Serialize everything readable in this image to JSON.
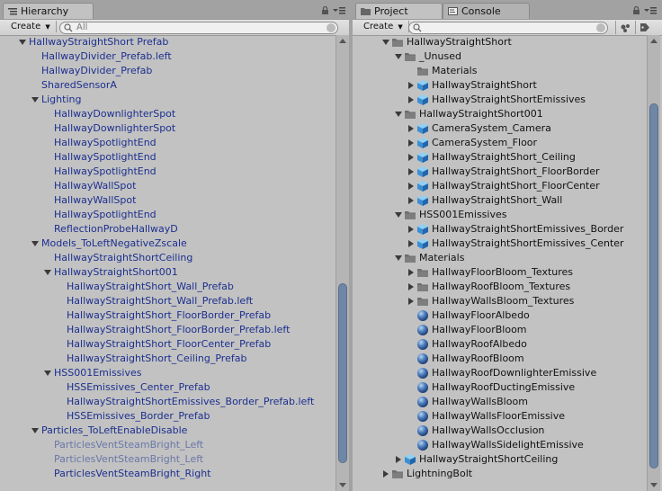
{
  "hierarchy": {
    "tab_label": "Hierarchy",
    "create_label": "Create",
    "search_placeholder": "All",
    "rows": [
      {
        "text": "HallwayStraightShort Prefab",
        "indent": 0,
        "arrow": "down",
        "color": "#1c2f8f"
      },
      {
        "text": "HallwayDivider_Prefab.left",
        "indent": 1,
        "arrow": "",
        "color": "#1c2f8f"
      },
      {
        "text": "HallwayDivider_Prefab",
        "indent": 1,
        "arrow": "",
        "color": "#1c2f8f"
      },
      {
        "text": "SharedSensorA",
        "indent": 1,
        "arrow": "",
        "color": "#1c2f8f"
      },
      {
        "text": "Lighting",
        "indent": 1,
        "arrow": "down",
        "color": "#1c2f8f"
      },
      {
        "text": "HallwayDownlighterSpot",
        "indent": 2,
        "arrow": "",
        "color": "#1c2f8f"
      },
      {
        "text": "HallwayDownlighterSpot",
        "indent": 2,
        "arrow": "",
        "color": "#1c2f8f"
      },
      {
        "text": "HallwaySpotlightEnd",
        "indent": 2,
        "arrow": "",
        "color": "#1c2f8f"
      },
      {
        "text": "HallwaySpotlightEnd",
        "indent": 2,
        "arrow": "",
        "color": "#1c2f8f"
      },
      {
        "text": "HallwaySpotlightEnd",
        "indent": 2,
        "arrow": "",
        "color": "#1c2f8f"
      },
      {
        "text": "HallwayWallSpot",
        "indent": 2,
        "arrow": "",
        "color": "#1c2f8f"
      },
      {
        "text": "HallwayWallSpot",
        "indent": 2,
        "arrow": "",
        "color": "#1c2f8f"
      },
      {
        "text": "HallwaySpotlightEnd",
        "indent": 2,
        "arrow": "",
        "color": "#1c2f8f"
      },
      {
        "text": "ReflectionProbeHallwayD",
        "indent": 2,
        "arrow": "",
        "color": "#1c2f8f"
      },
      {
        "text": "Models_ToLeftNegativeZscale",
        "indent": 1,
        "arrow": "down",
        "color": "#1c2f8f"
      },
      {
        "text": "HallwayStraightShortCeiling",
        "indent": 2,
        "arrow": "",
        "color": "#1c2f8f"
      },
      {
        "text": "HallwayStraightShort001",
        "indent": 2,
        "arrow": "down",
        "color": "#1c2f8f"
      },
      {
        "text": "HallwayStraightShort_Wall_Prefab",
        "indent": 3,
        "arrow": "",
        "color": "#1c2f8f"
      },
      {
        "text": "HallwayStraightShort_Wall_Prefab.left",
        "indent": 3,
        "arrow": "",
        "color": "#1c2f8f"
      },
      {
        "text": "HallwayStraightShort_FloorBorder_Prefab",
        "indent": 3,
        "arrow": "",
        "color": "#1c2f8f"
      },
      {
        "text": "HallwayStraightShort_FloorBorder_Prefab.left",
        "indent": 3,
        "arrow": "",
        "color": "#1c2f8f"
      },
      {
        "text": "HallwayStraightShort_FloorCenter_Prefab",
        "indent": 3,
        "arrow": "",
        "color": "#1c2f8f"
      },
      {
        "text": "HallwayStraightShort_Ceiling_Prefab",
        "indent": 3,
        "arrow": "",
        "color": "#1c2f8f"
      },
      {
        "text": "HSS001Emissives",
        "indent": 2,
        "arrow": "down",
        "color": "#1c2f8f"
      },
      {
        "text": "HSSEmissives_Center_Prefab",
        "indent": 3,
        "arrow": "",
        "color": "#1c2f8f"
      },
      {
        "text": "HallwayStraightShortEmissives_Border_Prefab.left",
        "indent": 3,
        "arrow": "",
        "color": "#1c2f8f"
      },
      {
        "text": "HSSEmissives_Border_Prefab",
        "indent": 3,
        "arrow": "",
        "color": "#1c2f8f"
      },
      {
        "text": "Particles_ToLeftEnableDisable",
        "indent": 1,
        "arrow": "down",
        "color": "#1c2f8f"
      },
      {
        "text": "ParticlesVentSteamBright_Left",
        "indent": 2,
        "arrow": "",
        "color": "#6a78a8"
      },
      {
        "text": "ParticlesVentSteamBright_Left",
        "indent": 2,
        "arrow": "",
        "color": "#6a78a8"
      },
      {
        "text": "ParticlesVentSteamBright_Right",
        "indent": 2,
        "arrow": "",
        "color": "#1c2f8f"
      }
    ]
  },
  "project": {
    "tab_label": "Project",
    "console_tab_label": "Console",
    "create_label": "Create",
    "search_placeholder": "",
    "rows": [
      {
        "text": "HallwayStraightShort",
        "indent": 0,
        "arrow": "down",
        "icon": "folder"
      },
      {
        "text": "_Unused",
        "indent": 1,
        "arrow": "down",
        "icon": "folder"
      },
      {
        "text": "Materials",
        "indent": 2,
        "arrow": "",
        "icon": "folder"
      },
      {
        "text": "HallwayStraightShort",
        "indent": 2,
        "arrow": "right",
        "icon": "prefab"
      },
      {
        "text": "HallwayStraightShortEmissives",
        "indent": 2,
        "arrow": "right",
        "icon": "prefab"
      },
      {
        "text": "HallwayStraightShort001",
        "indent": 1,
        "arrow": "down",
        "icon": "folder"
      },
      {
        "text": "CameraSystem_Camera",
        "indent": 2,
        "arrow": "right",
        "icon": "prefab"
      },
      {
        "text": "CameraSystem_Floor",
        "indent": 2,
        "arrow": "right",
        "icon": "prefab"
      },
      {
        "text": "HallwayStraightShort_Ceiling",
        "indent": 2,
        "arrow": "right",
        "icon": "prefab"
      },
      {
        "text": "HallwayStraightShort_FloorBorder",
        "indent": 2,
        "arrow": "right",
        "icon": "prefab"
      },
      {
        "text": "HallwayStraightShort_FloorCenter",
        "indent": 2,
        "arrow": "right",
        "icon": "prefab"
      },
      {
        "text": "HallwayStraightShort_Wall",
        "indent": 2,
        "arrow": "right",
        "icon": "prefab"
      },
      {
        "text": "HSS001Emissives",
        "indent": 1,
        "arrow": "down",
        "icon": "folder"
      },
      {
        "text": "HallwayStraightShortEmissives_Border",
        "indent": 2,
        "arrow": "right",
        "icon": "prefab"
      },
      {
        "text": "HallwayStraightShortEmissives_Center",
        "indent": 2,
        "arrow": "right",
        "icon": "prefab"
      },
      {
        "text": "Materials",
        "indent": 1,
        "arrow": "down",
        "icon": "folder"
      },
      {
        "text": "HallwayFloorBloom_Textures",
        "indent": 2,
        "arrow": "right",
        "icon": "folder"
      },
      {
        "text": "HallwayRoofBloom_Textures",
        "indent": 2,
        "arrow": "right",
        "icon": "folder"
      },
      {
        "text": "HallwayWallsBloom_Textures",
        "indent": 2,
        "arrow": "right",
        "icon": "folder"
      },
      {
        "text": "HallwayFloorAlbedo",
        "indent": 2,
        "arrow": "",
        "icon": "material"
      },
      {
        "text": "HallwayFloorBloom",
        "indent": 2,
        "arrow": "",
        "icon": "material"
      },
      {
        "text": "HallwayRoofAlbedo",
        "indent": 2,
        "arrow": "",
        "icon": "material"
      },
      {
        "text": "HallwayRoofBloom",
        "indent": 2,
        "arrow": "",
        "icon": "material"
      },
      {
        "text": "HallwayRoofDownlighterEmissive",
        "indent": 2,
        "arrow": "",
        "icon": "material"
      },
      {
        "text": "HallwayRoofDuctingEmissive",
        "indent": 2,
        "arrow": "",
        "icon": "material"
      },
      {
        "text": "HallwayWallsBloom",
        "indent": 2,
        "arrow": "",
        "icon": "material"
      },
      {
        "text": "HallwayWallsFloorEmissive",
        "indent": 2,
        "arrow": "",
        "icon": "material"
      },
      {
        "text": "HallwayWallsOcclusion",
        "indent": 2,
        "arrow": "",
        "icon": "material"
      },
      {
        "text": "HallwayWallsSidelightEmissive",
        "indent": 2,
        "arrow": "",
        "icon": "material"
      },
      {
        "text": "HallwayStraightShortCeiling",
        "indent": 1,
        "arrow": "right",
        "icon": "prefab"
      },
      {
        "text": "LightningBolt",
        "indent": 0,
        "arrow": "right",
        "icon": "folder"
      }
    ]
  },
  "colors": {
    "panel_bg": "#c2c2c2",
    "hierarchy_text": "#1c2f8f",
    "project_text": "#111111",
    "scroll_thumb": "#6f87a7"
  }
}
